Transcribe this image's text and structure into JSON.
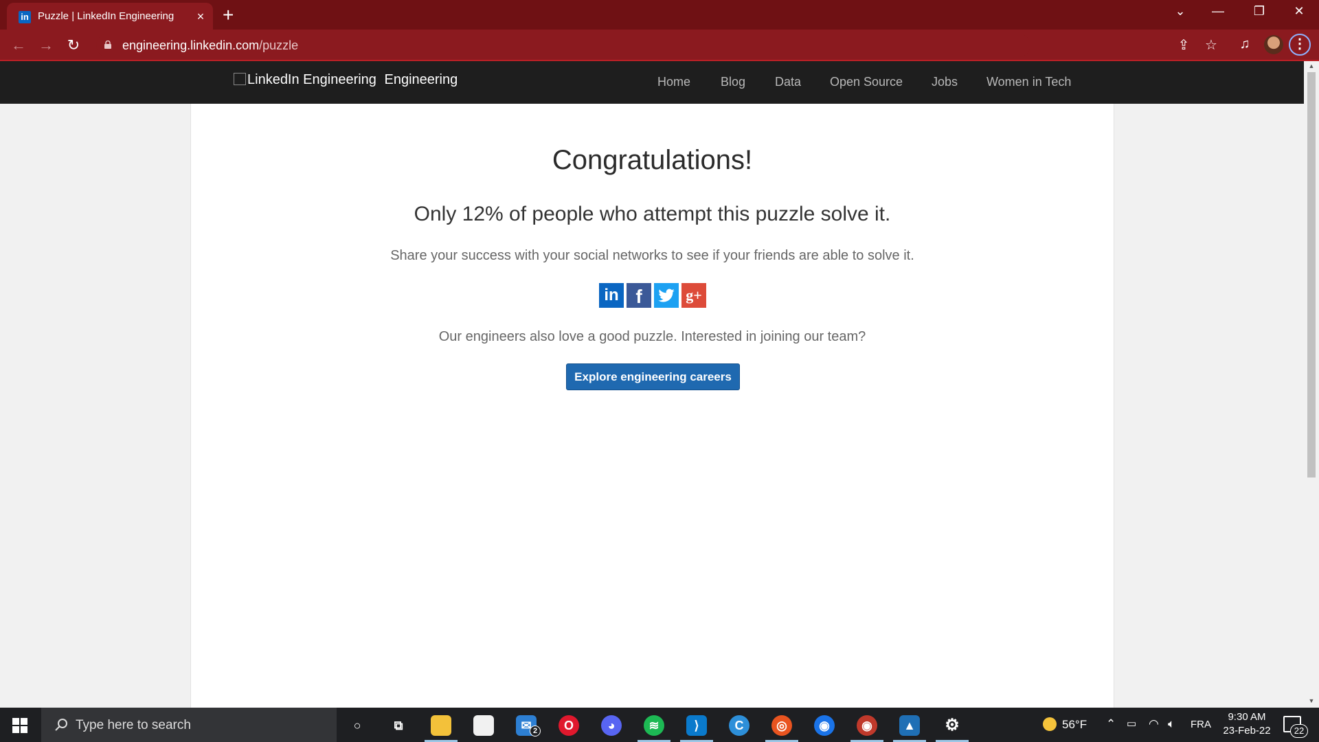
{
  "browser": {
    "tab": {
      "favicon": "in",
      "title": "Puzzle | LinkedIn Engineering",
      "close_icon": "×"
    },
    "new_tab_icon": "+",
    "window_controls": {
      "tab_search": "⌄",
      "minimize": "—",
      "restore": "❐",
      "close": "✕"
    },
    "toolbar": {
      "back_icon": "←",
      "forward_icon": "→",
      "reload_icon": "↻",
      "url_host": "engineering.linkedin.com",
      "url_path": "/puzzle",
      "share_icon": "⇪",
      "bookmark_icon": "☆",
      "media_icon": "♫",
      "menu_icon": "⋮"
    }
  },
  "site": {
    "logo_alt": "LinkedIn Engineering",
    "logo_label": "Engineering",
    "nav": [
      "Home",
      "Blog",
      "Data",
      "Open Source",
      "Jobs",
      "Women in Tech"
    ]
  },
  "main": {
    "headline": "Congratulations!",
    "subhead": "Only 12% of people who attempt this puzzle solve it.",
    "share_text": "Share your success with your social networks to see if your friends are able to solve it.",
    "social": [
      {
        "name": "linkedin",
        "glyph": "in",
        "color": "#0a66c2"
      },
      {
        "name": "facebook",
        "glyph": "f",
        "color": "#3b5998"
      },
      {
        "name": "twitter",
        "glyph": "t",
        "color": "#1da1f2"
      },
      {
        "name": "google-plus",
        "glyph": "g+",
        "color": "#dd4b39"
      }
    ],
    "team_text": "Our engineers also love a good puzzle. Interested in joining our team?",
    "cta_label": "Explore engineering careers"
  },
  "taskbar": {
    "search_placeholder": "Type here to search",
    "apps": [
      {
        "name": "cortana",
        "glyph": "○",
        "color": "transparent"
      },
      {
        "name": "task-view",
        "glyph": "⧉",
        "color": "transparent"
      },
      {
        "name": "file-explorer",
        "glyph": "",
        "color": "#f3c13a"
      },
      {
        "name": "microsoft-store",
        "glyph": "",
        "color": "#f1f1f1"
      },
      {
        "name": "mail",
        "glyph": "✉",
        "color": "#2d7fd3",
        "badge": "2"
      },
      {
        "name": "opera",
        "glyph": "O",
        "color": "#e0182d"
      },
      {
        "name": "discord",
        "glyph": "◕",
        "color": "#5865f2"
      },
      {
        "name": "spotify",
        "glyph": "≋",
        "color": "#1db954"
      },
      {
        "name": "vscode",
        "glyph": "⟩",
        "color": "#0a7acc"
      },
      {
        "name": "canva",
        "glyph": "C",
        "color": "#2d8fd9"
      },
      {
        "name": "ubuntu",
        "glyph": "◎",
        "color": "#e95420"
      },
      {
        "name": "chrome",
        "glyph": "◉",
        "color": "#1a73e8"
      },
      {
        "name": "chrome-profile",
        "glyph": "◉",
        "color": "#c0392b"
      },
      {
        "name": "photos",
        "glyph": "▲",
        "color": "#1f6fb5"
      },
      {
        "name": "settings",
        "glyph": "⚙",
        "color": "transparent"
      }
    ],
    "weather_temp": "56°F",
    "language": "FRA",
    "time": "9:30 AM",
    "date": "23-Feb-22",
    "notification_count": "22"
  }
}
